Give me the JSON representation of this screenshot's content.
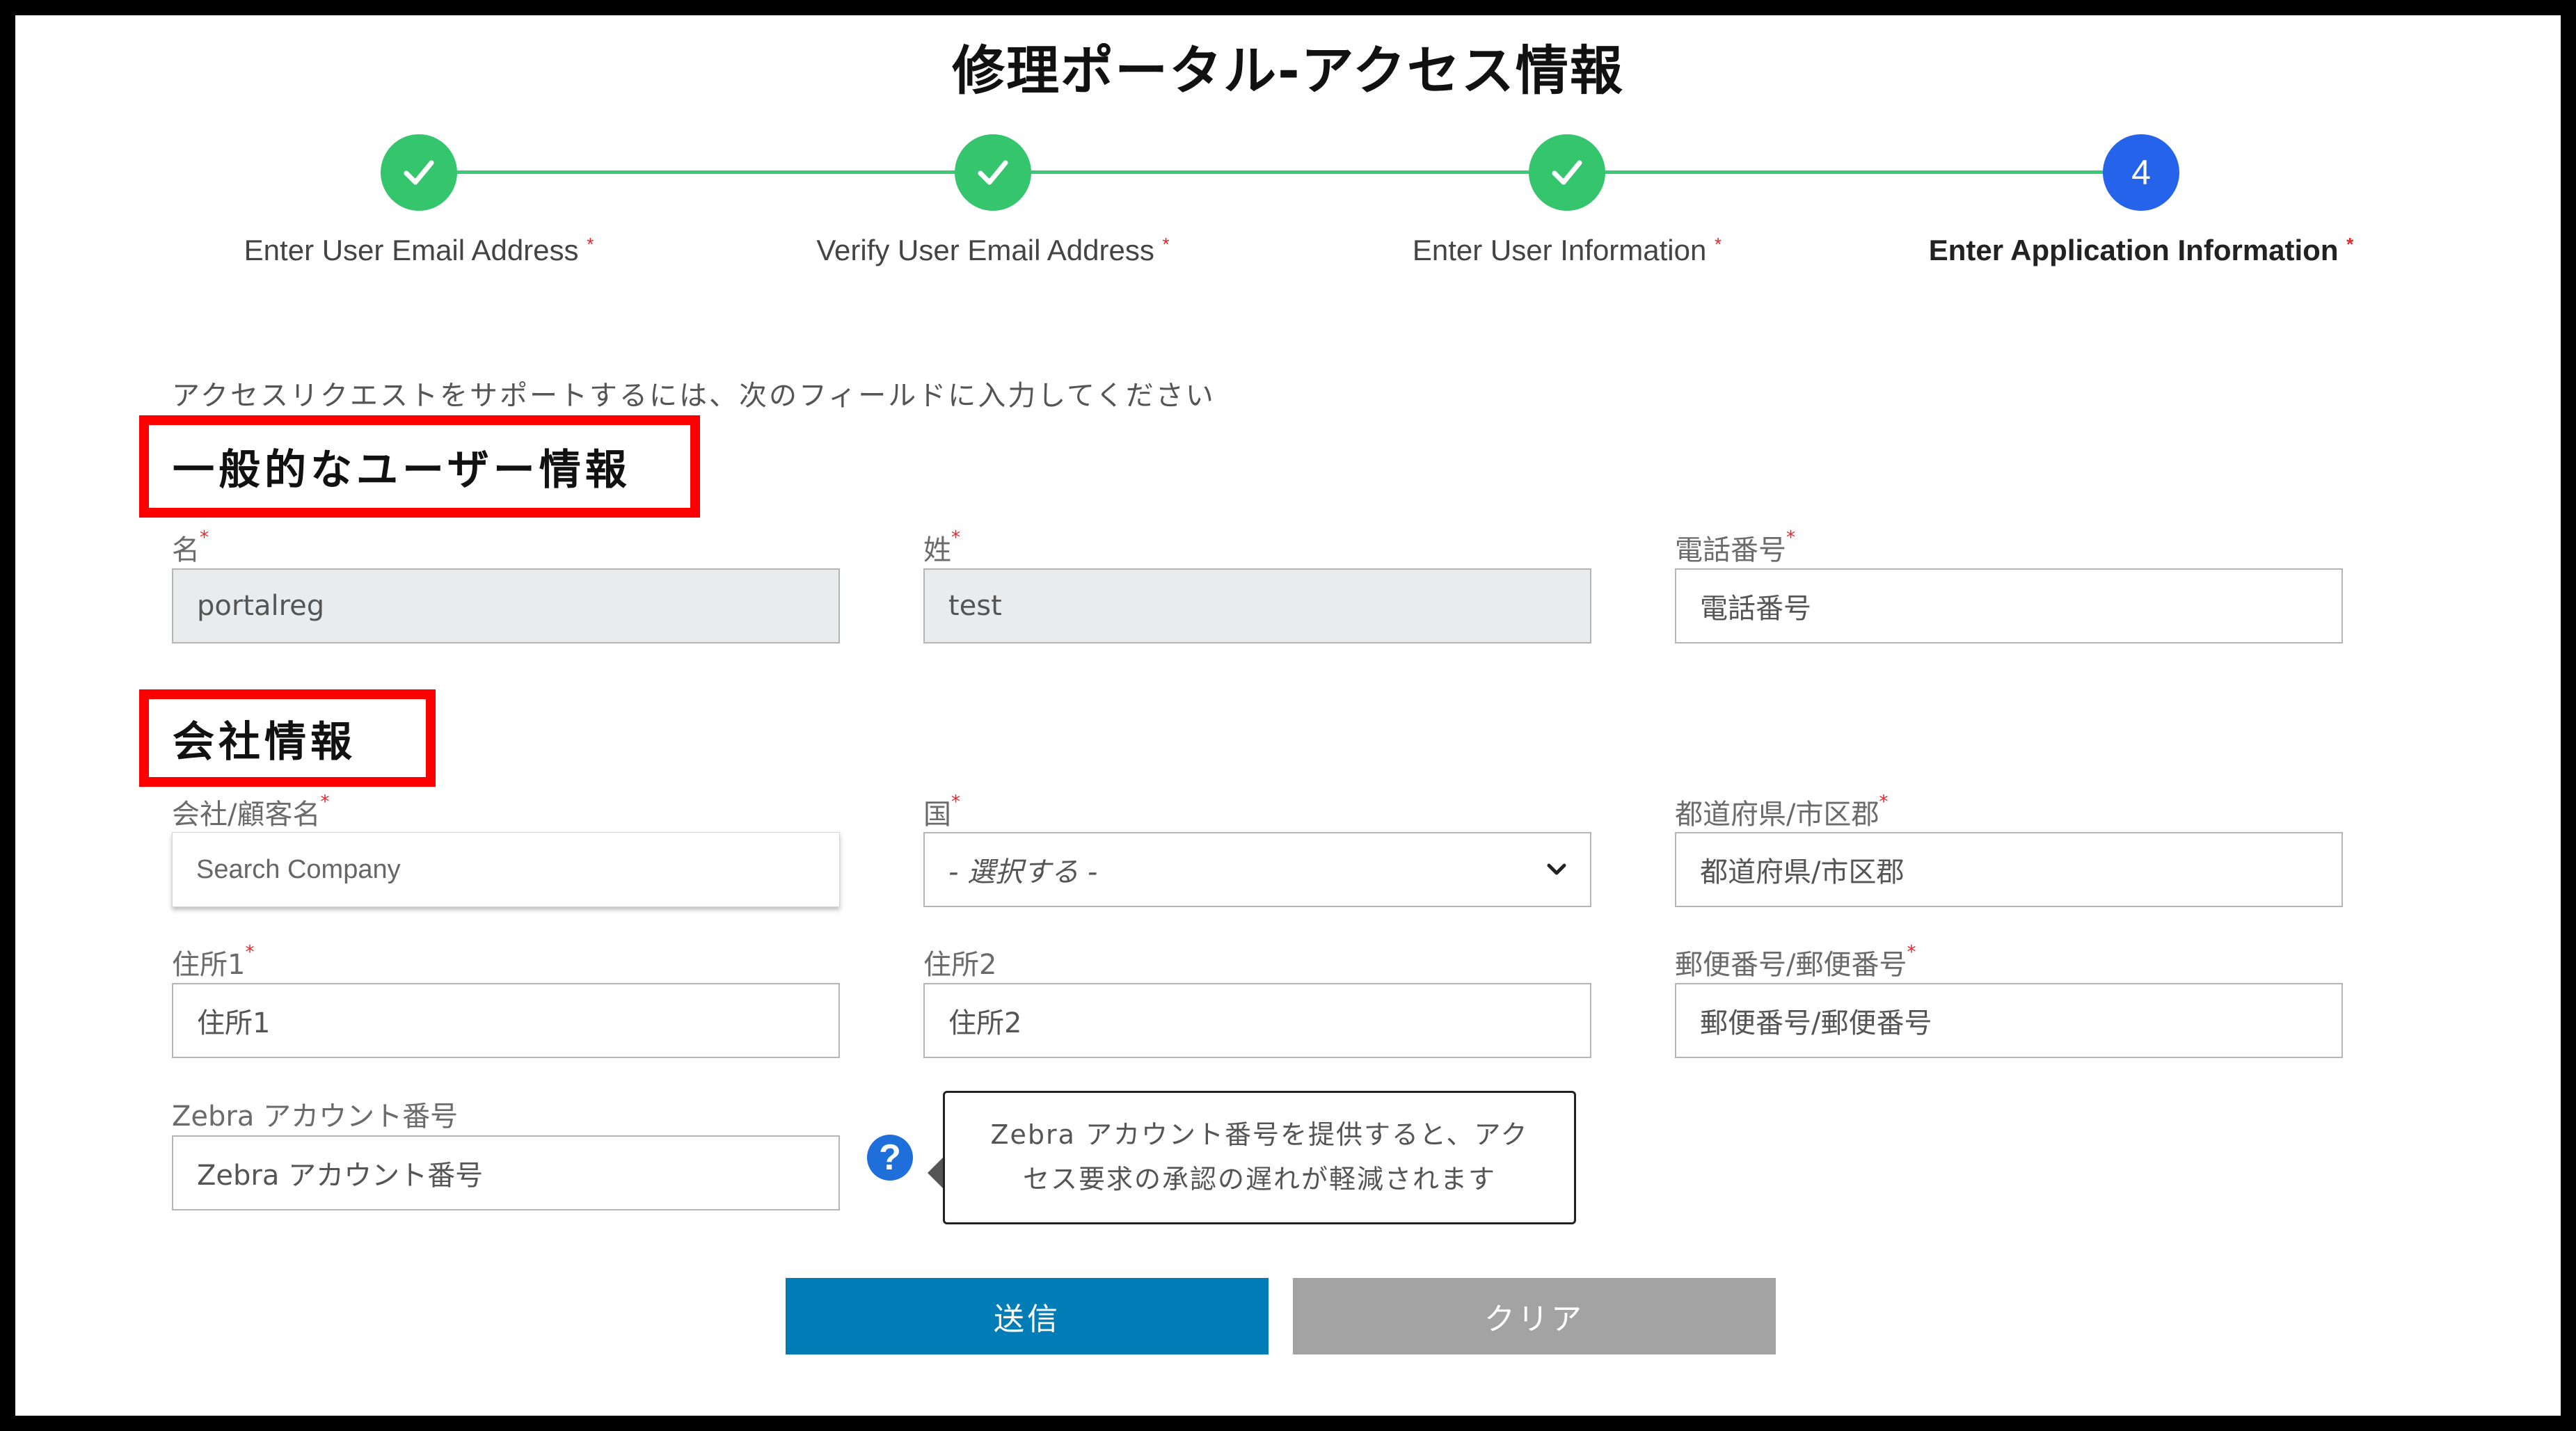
{
  "page": {
    "title": "修理ポータル-アクセス情報"
  },
  "stepper": {
    "steps": [
      {
        "label": "Enter User Email Address",
        "state": "done",
        "icon": "check-icon"
      },
      {
        "label": "Verify User Email Address",
        "state": "done",
        "icon": "check-icon"
      },
      {
        "label": "Enter User Information",
        "state": "done",
        "icon": "check-icon"
      },
      {
        "label": "Enter Application Information",
        "state": "current",
        "number": "4"
      }
    ],
    "required_mark": "*",
    "colors": {
      "done": "#35c56c",
      "current": "#2563eb",
      "line": "#3ec97a"
    }
  },
  "form": {
    "intro": "アクセスリクエストをサポートするには、次のフィールドに入力してください",
    "required_mark": "*",
    "general_section": {
      "heading": "一般的なユーザー情報",
      "first_name": {
        "label": "名",
        "value": "portalreg"
      },
      "last_name": {
        "label": "姓",
        "value": "test"
      },
      "phone": {
        "label": "電話番号",
        "placeholder": "電話番号"
      }
    },
    "company_section": {
      "heading": "会社情報",
      "company": {
        "label": "会社/顧客名",
        "placeholder": "Search Company"
      },
      "country": {
        "label": "国",
        "selected": "- 選択する -"
      },
      "prefecture": {
        "label": "都道府県/市区郡",
        "placeholder": "都道府県/市区郡"
      },
      "address1": {
        "label": "住所1",
        "placeholder": "住所1"
      },
      "address2": {
        "label": "住所2",
        "placeholder": "住所2"
      },
      "postal": {
        "label": "郵便番号/郵便番号",
        "placeholder": "郵便番号/郵便番号"
      },
      "account": {
        "label": "Zebra アカウント番号",
        "placeholder": "Zebra アカウント番号"
      },
      "account_help": {
        "icon": "?",
        "tooltip_line1": "Zebra アカウント番号を提供すると、アク",
        "tooltip_line2": "セス要求の承認の遅れが軽減されます"
      }
    },
    "buttons": {
      "submit": "送信",
      "clear": "クリア"
    }
  }
}
